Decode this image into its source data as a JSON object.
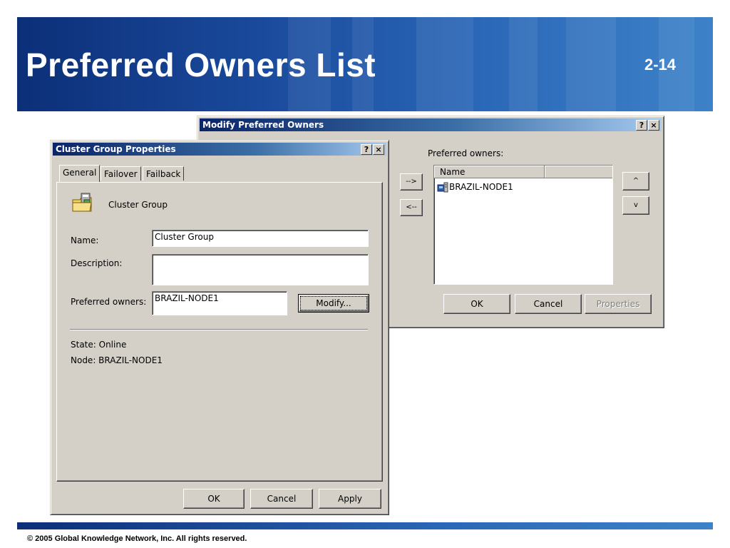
{
  "slide": {
    "title": "Preferred Owners List",
    "page_number": "2-14",
    "copyright": "© 2005 Global Knowledge Network, Inc. All rights reserved."
  },
  "modify_dialog": {
    "title": "Modify Preferred Owners",
    "help_button": "?",
    "close_button": "×",
    "preferred_owners_label": "Preferred owners:",
    "add_button": "-->",
    "remove_button": "<--",
    "list_header": {
      "name": "Name",
      "col2": ""
    },
    "list_items": [
      "BRAZIL-NODE1"
    ],
    "move_up_button": "^",
    "move_down_button": "v",
    "ok_button": "OK",
    "cancel_button": "Cancel",
    "properties_button": "Properties"
  },
  "props_dialog": {
    "title": "Cluster Group Properties",
    "help_button": "?",
    "close_button": "×",
    "tabs": [
      "General",
      "Failover",
      "Failback"
    ],
    "group_label": "Cluster Group",
    "name_label": "Name:",
    "name_value": "Cluster Group",
    "description_label": "Description:",
    "description_value": "",
    "preferred_owners_label": "Preferred owners:",
    "preferred_owners_value": "BRAZIL-NODE1",
    "modify_button": "Modify...",
    "state_text": "State:  Online",
    "node_text": "Node:  BRAZIL-NODE1",
    "ok_button": "OK",
    "cancel_button": "Cancel",
    "apply_button": "Apply"
  }
}
